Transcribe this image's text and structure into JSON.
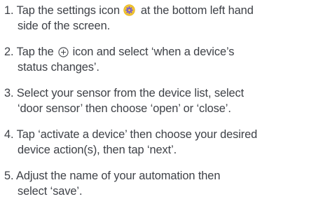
{
  "colors": {
    "text": "#3e4147",
    "settings_icon_fill": "#f2c72e",
    "settings_icon_ring": "#7a5ccf"
  },
  "icons": {
    "settings": "settings-gear-icon",
    "add": "circled-plus-icon"
  },
  "steps": [
    {
      "line1_before_icon": "1. Tap the settings icon",
      "line1_after_icon": "at the bottom left hand",
      "line2": "side of the screen."
    },
    {
      "line1_before_icon": "2. Tap the",
      "line1_after_icon": "icon and select ‘when a device’s",
      "line2": "status changes’."
    },
    {
      "line1": "3. Select your sensor from the device list, select",
      "line2": "‘door sensor’ then choose ‘open’ or ‘close’."
    },
    {
      "line1": "4. Tap ‘activate a device’ then choose your desired",
      "line2": "device action(s), then tap ‘next’."
    },
    {
      "line1": "5. Adjust the name of your automation then",
      "line2": "select ‘save’."
    }
  ]
}
